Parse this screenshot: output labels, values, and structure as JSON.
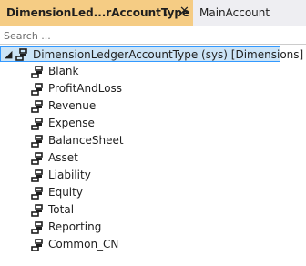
{
  "tabs": {
    "active": {
      "title": "DimensionLed...rAccountType",
      "pin_glyph": "⊸",
      "close_glyph": "✕"
    },
    "inactive": {
      "title": "MainAccount"
    }
  },
  "search": {
    "placeholder": "Search ...",
    "value": ""
  },
  "tree": {
    "root": {
      "expander_glyph": "◢",
      "label": "DimensionLedgerAccountType (sys) [Dimensions]",
      "icon": "enum-icon"
    },
    "items": [
      {
        "label": "Blank",
        "icon": "enum-value-icon"
      },
      {
        "label": "ProfitAndLoss",
        "icon": "enum-value-icon"
      },
      {
        "label": "Revenue",
        "icon": "enum-value-icon"
      },
      {
        "label": "Expense",
        "icon": "enum-value-icon"
      },
      {
        "label": "BalanceSheet",
        "icon": "enum-value-icon"
      },
      {
        "label": "Asset",
        "icon": "enum-value-icon"
      },
      {
        "label": "Liability",
        "icon": "enum-value-icon"
      },
      {
        "label": "Equity",
        "icon": "enum-value-icon"
      },
      {
        "label": "Total",
        "icon": "enum-value-icon"
      },
      {
        "label": "Reporting",
        "icon": "enum-value-icon"
      },
      {
        "label": "Common_CN",
        "icon": "enum-value-icon"
      }
    ]
  },
  "colors": {
    "active_tab": "#f5cc84",
    "selection_fill": "#cce4f7",
    "selection_border": "#3399ff",
    "icon": "#1e1e1e"
  }
}
